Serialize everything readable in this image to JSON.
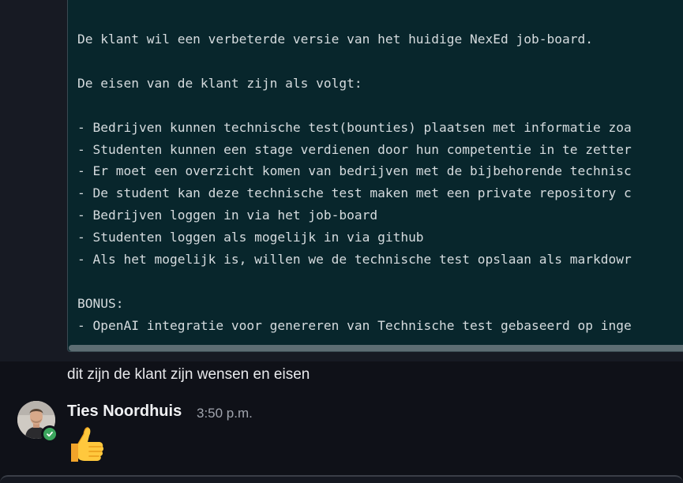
{
  "code_message": {
    "lines": [
      "De klant wil een verbeterde versie van het huidige NexEd job-board.",
      "",
      "De eisen van de klant zijn als volgt:",
      "",
      "- Bedrijven kunnen technische test(bounties) plaatsen met informatie zoa",
      "- Studenten kunnen een stage verdienen door hun competentie in te zetter",
      "- Er moet een overzicht komen van bedrijven met de bijbehorende technisc",
      "- De student kan deze technische test maken met een private repository c",
      "- Bedrijven loggen in via het job-board",
      "- Studenten loggen als mogelijk in via github",
      "- Als het mogelijk is, willen we de technische test opslaan als markdowr",
      "",
      "BONUS:",
      "- OpenAI integratie voor genereren van Technische test gebaseerd op inge"
    ],
    "followup_text": "dit zijn de klant zijn wensen en eisen"
  },
  "reply_message": {
    "author": "Ties Noordhuis",
    "timestamp": "3:50 p.m.",
    "emoji": "👍",
    "emoji_icon": "thumbs-up-icon",
    "presence_status": "online"
  },
  "colors": {
    "code_background": "#08262c",
    "presence_online": "#3ba55d"
  }
}
